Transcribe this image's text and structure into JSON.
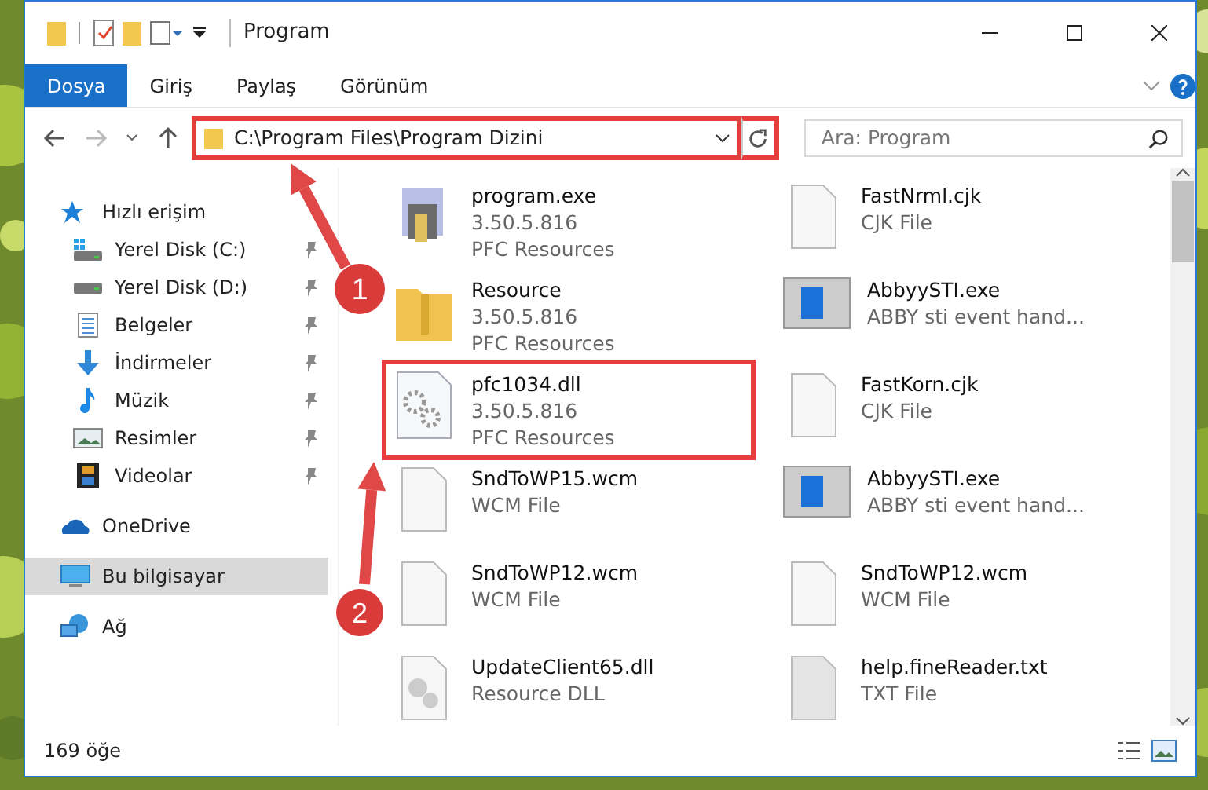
{
  "window": {
    "title": "Program"
  },
  "ribbon_tabs": [
    {
      "label": "Dosya",
      "selected": true
    },
    {
      "label": "Giriş",
      "selected": false
    },
    {
      "label": "Paylaş",
      "selected": false
    },
    {
      "label": "Görünüm",
      "selected": false
    }
  ],
  "address_bar": {
    "path": "C:\\Program Files\\Program Dizini",
    "highlighted": true
  },
  "search": {
    "placeholder": "Ara: Program"
  },
  "sidebar": {
    "items": [
      {
        "label": "Hızlı erişim",
        "pinned": false,
        "selected": false,
        "children": [
          {
            "label": "Yerel Disk (C:)",
            "pinned": true,
            "selected": false
          },
          {
            "label": "Yerel Disk (D:)",
            "pinned": true,
            "selected": false
          },
          {
            "label": "Belgeler",
            "pinned": true,
            "selected": false
          },
          {
            "label": "İndirmeler",
            "pinned": true,
            "selected": false
          },
          {
            "label": "Müzik",
            "pinned": true,
            "selected": false
          },
          {
            "label": "Resimler",
            "pinned": true,
            "selected": false
          },
          {
            "label": "Videolar",
            "pinned": true,
            "selected": false
          }
        ]
      },
      {
        "label": "OneDrive",
        "pinned": false,
        "selected": false
      },
      {
        "label": "Bu bilgisayar",
        "pinned": false,
        "selected": true
      },
      {
        "label": "Ağ",
        "pinned": false,
        "selected": false
      }
    ]
  },
  "files": [
    {
      "name": "program.exe",
      "lines": [
        "3.50.5.816",
        "PFC Resources"
      ],
      "kind": "exe",
      "highlighted": false
    },
    {
      "name": "FastNrml.cjk",
      "lines": [
        "CJK File"
      ],
      "kind": "blank",
      "highlighted": false
    },
    {
      "name": "Resource",
      "lines": [
        "3.50.5.816",
        "PFC Resources"
      ],
      "kind": "archive",
      "highlighted": false
    },
    {
      "name": "AbbyySTI.exe",
      "lines": [
        "ABBY sti event hand..."
      ],
      "kind": "app",
      "highlighted": false
    },
    {
      "name": "pfc1034.dll",
      "lines": [
        "3.50.5.816",
        "PFC Resources"
      ],
      "kind": "dll",
      "highlighted": true
    },
    {
      "name": "FastKorn.cjk",
      "lines": [
        "CJK File"
      ],
      "kind": "blank",
      "highlighted": false
    },
    {
      "name": "SndToWP15.wcm",
      "lines": [
        "WCM File"
      ],
      "kind": "blank",
      "highlighted": false
    },
    {
      "name": "AbbyySTI.exe",
      "lines": [
        "ABBY sti event hand..."
      ],
      "kind": "app",
      "highlighted": false
    },
    {
      "name": "SndToWP12.wcm",
      "lines": [
        "WCM File"
      ],
      "kind": "blank",
      "highlighted": false
    },
    {
      "name": "SndToWP12.wcm",
      "lines": [
        "WCM File"
      ],
      "kind": "blank",
      "highlighted": false
    },
    {
      "name": "UpdateClient65.dll",
      "lines": [
        "Resource DLL"
      ],
      "kind": "dll-gray",
      "highlighted": false
    },
    {
      "name": "help.fineReader.txt",
      "lines": [
        "TXT File"
      ],
      "kind": "txt",
      "highlighted": false
    }
  ],
  "status_bar": {
    "count": "169 öğe"
  },
  "callouts": [
    {
      "number": "1"
    },
    {
      "number": "2"
    }
  ]
}
